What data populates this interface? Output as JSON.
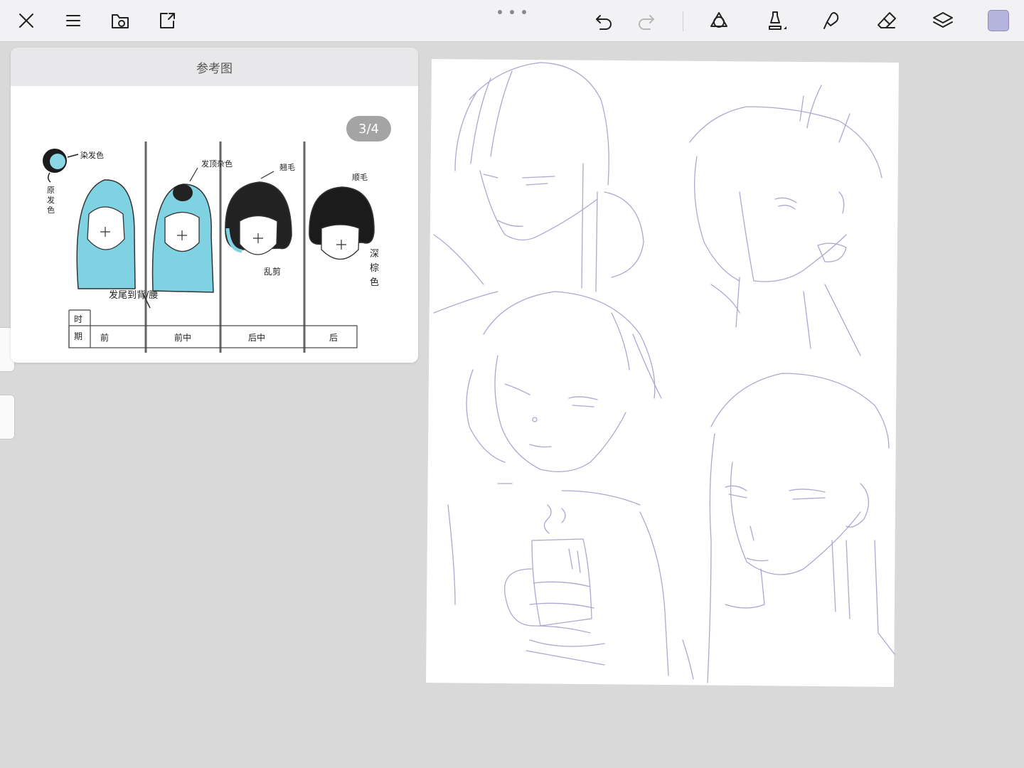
{
  "toolbar": {
    "left_icons": [
      "close-icon",
      "menu-icon",
      "gallery-icon",
      "import-icon"
    ],
    "right_icons": [
      "undo-icon",
      "redo-icon",
      "shapes-icon",
      "brush-icon",
      "smudge-icon",
      "eraser-icon",
      "layers-icon"
    ],
    "current_color": "#b4b4dc"
  },
  "reference_panel": {
    "title": "参考图",
    "page_indicator": "3/4",
    "labels": {
      "dye_color": "染发色",
      "original_color": "原发色",
      "crown_mixed": "发顶杂色",
      "curly": "翘毛",
      "straight": "顺毛",
      "messy": "乱剪",
      "dark_brown": "深棕色",
      "length": "发尾到背/腰",
      "period": "时期",
      "stages": [
        "前",
        "前中",
        "后中",
        "后"
      ]
    }
  },
  "canvas": {
    "sketch_color": "#a9a9d2",
    "paper_color": "#ffffff"
  }
}
